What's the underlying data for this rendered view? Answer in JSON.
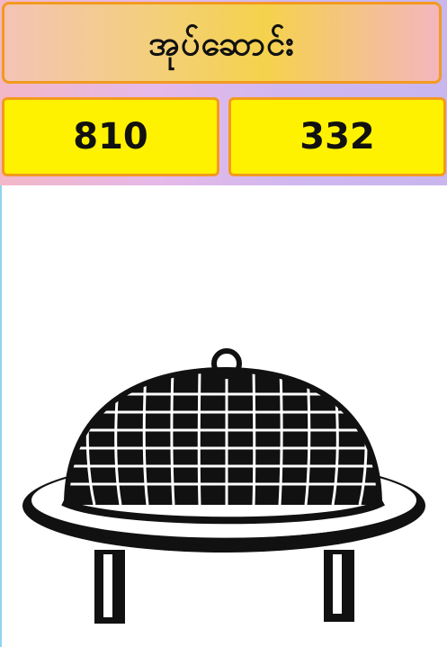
{
  "header": {
    "title": "အုပ်ဆောင်း"
  },
  "numbers": {
    "left": "810",
    "right": "332"
  },
  "image": {
    "subject": "dome-food-cover-on-tray-icon"
  },
  "colors": {
    "border": "#f39a1f",
    "number_bg": "#fff200",
    "ink": "#111111"
  }
}
